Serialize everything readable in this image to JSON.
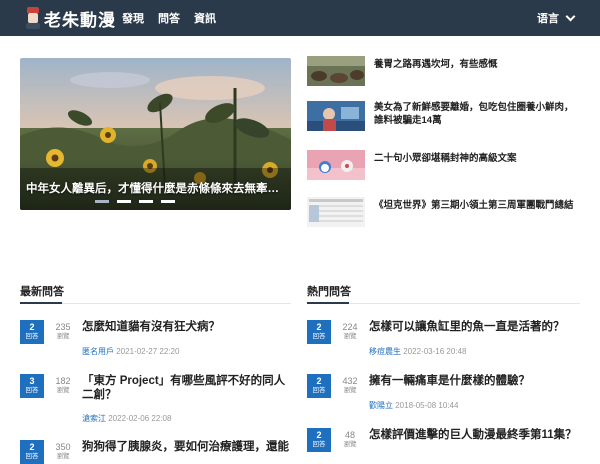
{
  "header": {
    "logo_text": "老朱動漫",
    "nav": [
      "發現",
      "問答",
      "資訊"
    ],
    "language": "语言"
  },
  "hero": {
    "caption": "中年女人離異后，才懂得什麼是赤條條來去無牽挂..."
  },
  "side_articles": [
    {
      "title": "養胃之路再遇坎坷，有些感慨"
    },
    {
      "title": "美女為了新鮮感要離婚，包吃包住圈養小鮮肉，誰料被騙走14萬"
    },
    {
      "title": "二十句小眾卻堪稱封神的高級文案"
    },
    {
      "title": "《坦克世界》第三期小領土第三周軍團戰鬥總結"
    }
  ],
  "latest": {
    "title": "最新問答",
    "answers_label": "回答",
    "views_label": "瀏覽",
    "items": [
      {
        "answers": "2",
        "views": "235",
        "question": "怎麼知道貓有沒有狂犬病？",
        "user": "匿名用戶",
        "date": "2021-02-27 22:20"
      },
      {
        "answers": "3",
        "views": "182",
        "question": "「東方 Project」有哪些風評不好的同人二創？",
        "user": "滄索江",
        "date": "2022-02-06 22:08"
      },
      {
        "answers": "2",
        "views": "350",
        "question": "狗狗得了胰腺炎，要如何治療護理，還能",
        "user": "",
        "date": ""
      }
    ]
  },
  "hot": {
    "title": "熱門問答",
    "answers_label": "回答",
    "views_label": "瀏覽",
    "items": [
      {
        "answers": "2",
        "views": "224",
        "question": "怎樣可以讓魚缸里的魚一直是活著的？",
        "user": "移痘農生",
        "date": "2022-03-16 20:48"
      },
      {
        "answers": "2",
        "views": "432",
        "question": "擁有一輛痛車是什麼樣的體驗？",
        "user": "歡陽立",
        "date": "2018-05-08 10:44"
      },
      {
        "answers": "2",
        "views": "48",
        "question": "怎樣評價進擊的巨人動漫最終季第11集？",
        "user": "",
        "date": ""
      }
    ]
  },
  "icons": {
    "language_dropdown": "chevron-down-icon",
    "logo": "logo-icon"
  },
  "colors": {
    "header_bg": "#2b3a4a",
    "badge": "#1f6fbf",
    "accent": "#2b3a4a"
  }
}
